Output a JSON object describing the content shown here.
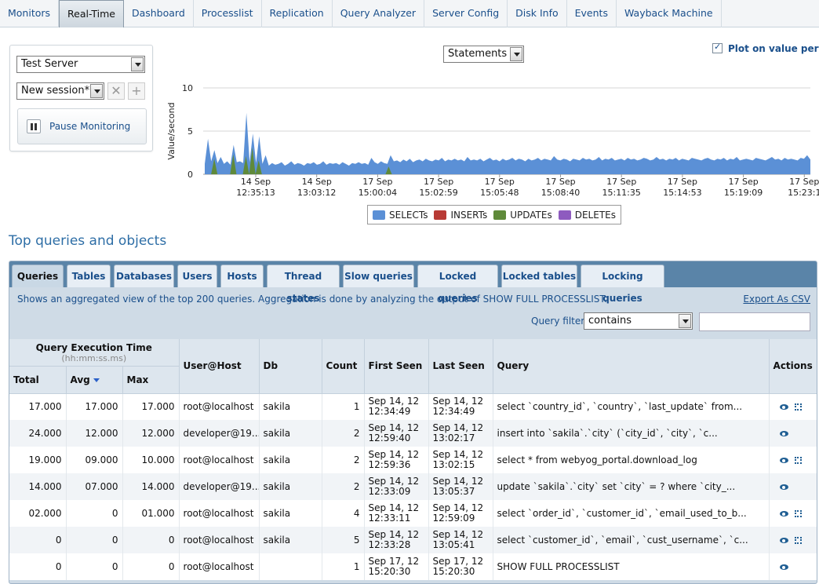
{
  "nav": {
    "tabs": [
      "Monitors",
      "Real-Time",
      "Dashboard",
      "Processlist",
      "Replication",
      "Query Analyzer",
      "Server Config",
      "Disk Info",
      "Events",
      "Wayback Machine"
    ],
    "active": "Real-Time"
  },
  "controls": {
    "server": "Test Server",
    "session": "New session*",
    "pause_label": "Pause Monitoring"
  },
  "chart_controls": {
    "metric": "Statements",
    "plot_per_sec_label": "Plot on value per sec",
    "plot_per_sec_checked": true
  },
  "chart_data": {
    "type": "area",
    "ylabel": "Value/second",
    "ylim": [
      0,
      10
    ],
    "yticks": [
      "10",
      "5",
      "0"
    ],
    "x_ticks": [
      {
        "date": "14 Sep",
        "time": "12:35:13"
      },
      {
        "date": "14 Sep",
        "time": "13:03:12"
      },
      {
        "date": "17 Sep",
        "time": "15:00:04"
      },
      {
        "date": "17 Sep",
        "time": "15:02:59"
      },
      {
        "date": "17 Sep",
        "time": "15:05:48"
      },
      {
        "date": "17 Sep",
        "time": "15:08:40"
      },
      {
        "date": "17 Sep",
        "time": "15:11:35"
      },
      {
        "date": "17 Sep",
        "time": "15:14:53"
      },
      {
        "date": "17 Sep",
        "time": "15:19:09"
      },
      {
        "date": "17 Sep",
        "time": "15:23:1"
      }
    ],
    "series": [
      {
        "name": "SELECTs",
        "color": "#5b90d6",
        "values": [
          1.2,
          4.1,
          1.5,
          2.8,
          1.3,
          2.0,
          1.2,
          1.5,
          1.1,
          3.4,
          1.4,
          1.5,
          1.3,
          7.1,
          1.4,
          4.7,
          1.3,
          4.4,
          1.2,
          2.2,
          1.0,
          1.3,
          1.1,
          1.2,
          1.4,
          1.0,
          1.2,
          1.5,
          1.1,
          1.3,
          1.2,
          1.0,
          1.3,
          1.2,
          1.4,
          1.1,
          1.2,
          1.5,
          1.1,
          1.3,
          1.2,
          1.3,
          1.1,
          1.4,
          1.2,
          1.0,
          1.3,
          1.2,
          1.4,
          1.2,
          1.3,
          1.1,
          1.9,
          1.4,
          1.2,
          1.5,
          1.3,
          1.2,
          2.2,
          1.5,
          1.6,
          1.4,
          1.7,
          1.5,
          1.8,
          1.4,
          1.6,
          1.7,
          1.5,
          1.8,
          1.6,
          1.5,
          1.7,
          1.6,
          1.9,
          1.5,
          1.7,
          1.6,
          1.8,
          1.6,
          1.7,
          1.5,
          2.0,
          1.6,
          1.7,
          1.6,
          1.8,
          1.5,
          1.7,
          1.9,
          1.6,
          1.7,
          1.5,
          1.8,
          1.6,
          1.7,
          1.9,
          1.6,
          1.8,
          1.7,
          1.5,
          1.8,
          1.6,
          1.7,
          1.9,
          1.6,
          1.8,
          1.7,
          1.6,
          2.1,
          1.7,
          1.6,
          1.8,
          1.7,
          1.5,
          1.8,
          1.7,
          1.6,
          1.9,
          1.7,
          1.8,
          1.6,
          1.7,
          2.0,
          1.6,
          1.8,
          1.7,
          1.9,
          1.6,
          1.7,
          1.8,
          1.6,
          1.9,
          1.7,
          1.8,
          1.6,
          1.7,
          1.9,
          1.8,
          1.6,
          1.7,
          2.0,
          1.7,
          1.8,
          1.6,
          1.8,
          1.7,
          1.9,
          1.6,
          1.8,
          1.7,
          1.6,
          1.9,
          1.8,
          1.7,
          1.6,
          1.8,
          1.9,
          1.7,
          1.6,
          1.8,
          1.7,
          1.9,
          1.6,
          1.8,
          1.7,
          2.0,
          1.6,
          1.7,
          1.8,
          1.7,
          1.6,
          1.9,
          1.8,
          1.7,
          1.6,
          1.8,
          2.0,
          1.7,
          1.8,
          1.6,
          1.9,
          1.7,
          1.8,
          1.7,
          1.6,
          1.9,
          1.8,
          2.2,
          1.7
        ]
      },
      {
        "name": "INSERTs",
        "color": "#b83a35",
        "values": []
      },
      {
        "name": "UPDATEs",
        "color": "#5f8a3a",
        "values": [
          0,
          0,
          0,
          1.8,
          0,
          0,
          0,
          0,
          0,
          2.3,
          0,
          0,
          0,
          2.1,
          0,
          3.1,
          0,
          1.6,
          0,
          0,
          0,
          0,
          0,
          0,
          0,
          0,
          0,
          0,
          0,
          0,
          0,
          0,
          0,
          0,
          0,
          0,
          0,
          0,
          0,
          0,
          0,
          0,
          0,
          0,
          0,
          0,
          0,
          0,
          0,
          0,
          0,
          0,
          0,
          0,
          0,
          0,
          0,
          0,
          0.9,
          0,
          0,
          0,
          0,
          0,
          0,
          0,
          0,
          0,
          0,
          0,
          0,
          0,
          0,
          0,
          0,
          0,
          0,
          0,
          0,
          0,
          0,
          0,
          0,
          0,
          0,
          0,
          0,
          0,
          0,
          0,
          0,
          0,
          0,
          0,
          0,
          0,
          0,
          0,
          0,
          0,
          0,
          0,
          0,
          0,
          0,
          0,
          0,
          0,
          0,
          0,
          0,
          0,
          0,
          0,
          0,
          0,
          0,
          0,
          0,
          0,
          0,
          0,
          0,
          0,
          0,
          0,
          0,
          0,
          0,
          0,
          0,
          0,
          0,
          0,
          0,
          0,
          0,
          0,
          0,
          0,
          0,
          0,
          0,
          0,
          0,
          0,
          0,
          0,
          0,
          0,
          0,
          0,
          0,
          0,
          0,
          0,
          0,
          0,
          0,
          0,
          0,
          0,
          0,
          0,
          0,
          0,
          0,
          0,
          0,
          0,
          0,
          0,
          0,
          0,
          0,
          0,
          0,
          0,
          0,
          0,
          0,
          0,
          0,
          0,
          0,
          0,
          0,
          0,
          0,
          0,
          0,
          0
        ]
      },
      {
        "name": "DELETEs",
        "color": "#8e5bbf",
        "values": []
      }
    ]
  },
  "section_title": "Top queries and objects",
  "panel": {
    "tabs": [
      "Queries",
      "Tables",
      "Databases",
      "Users",
      "Hosts",
      "Thread states",
      "Slow queries",
      "Locked queries",
      "Locked tables",
      "Locking queries"
    ],
    "active": "Queries",
    "description": "Shows an aggregated view of the top 200 queries. Aggregation is done by analyzing the output of SHOW FULL PROCESSLIST.",
    "export_label": "Export As CSV",
    "filter_label": "Query filter",
    "filter_mode": "contains",
    "filter_value": ""
  },
  "table": {
    "group_header": "Query Execution Time",
    "group_sub": "(hh:mm:ss.ms)",
    "headers": {
      "total": "Total",
      "avg": "Avg",
      "max": "Max",
      "user": "User@Host",
      "db": "Db",
      "count": "Count",
      "first": "First Seen",
      "last": "Last Seen",
      "query": "Query",
      "actions": "Actions"
    },
    "rows": [
      {
        "total": "17.000",
        "avg": "17.000",
        "max": "17.000",
        "user": "root@localhost",
        "db": "sakila",
        "count": "1",
        "first_d": "Sep 14, 12",
        "first_t": "12:34:49",
        "last_d": "Sep 14, 12",
        "last_t": "12:34:49",
        "query": "select `country_id`, `country`, `last_update` from...",
        "expand": true
      },
      {
        "total": "24.000",
        "avg": "12.000",
        "max": "12.000",
        "user": "developer@19...",
        "db": "sakila",
        "count": "2",
        "first_d": "Sep 14, 12",
        "first_t": "12:59:40",
        "last_d": "Sep 14, 12",
        "last_t": "13:02:17",
        "query": "insert into `sakila`.`city` (`city_id`, `city`, `c...",
        "expand": false
      },
      {
        "total": "19.000",
        "avg": "09.000",
        "max": "10.000",
        "user": "root@localhost",
        "db": "sakila",
        "count": "2",
        "first_d": "Sep 14, 12",
        "first_t": "12:59:36",
        "last_d": "Sep 14, 12",
        "last_t": "13:02:15",
        "query": "select * from webyog_portal.download_log",
        "expand": true
      },
      {
        "total": "14.000",
        "avg": "07.000",
        "max": "14.000",
        "user": "developer@19...",
        "db": "sakila",
        "count": "2",
        "first_d": "Sep 14, 12",
        "first_t": "12:33:09",
        "last_d": "Sep 14, 12",
        "last_t": "13:05:37",
        "query": "update `sakila`.`city` set `city` = ? where `city_...",
        "expand": false
      },
      {
        "total": "02.000",
        "avg": "0",
        "max": "01.000",
        "user": "root@localhost",
        "db": "sakila",
        "count": "4",
        "first_d": "Sep 14, 12",
        "first_t": "12:33:11",
        "last_d": "Sep 14, 12",
        "last_t": "12:59:09",
        "query": "select `order_id`, `customer_id`, `email_used_to_b...",
        "expand": true
      },
      {
        "total": "0",
        "avg": "0",
        "max": "0",
        "user": "root@localhost",
        "db": "sakila",
        "count": "5",
        "first_d": "Sep 14, 12",
        "first_t": "12:33:28",
        "last_d": "Sep 14, 12",
        "last_t": "13:05:41",
        "query": "select `customer_id`, `email`, `cust_username`, `c...",
        "expand": true
      },
      {
        "total": "0",
        "avg": "0",
        "max": "0",
        "user": "root@localhost",
        "db": "",
        "count": "1",
        "first_d": "Sep 17, 12",
        "first_t": "15:20:30",
        "last_d": "Sep 17, 12",
        "last_t": "15:20:30",
        "query": "SHOW FULL PROCESSLIST",
        "expand": false
      }
    ]
  }
}
